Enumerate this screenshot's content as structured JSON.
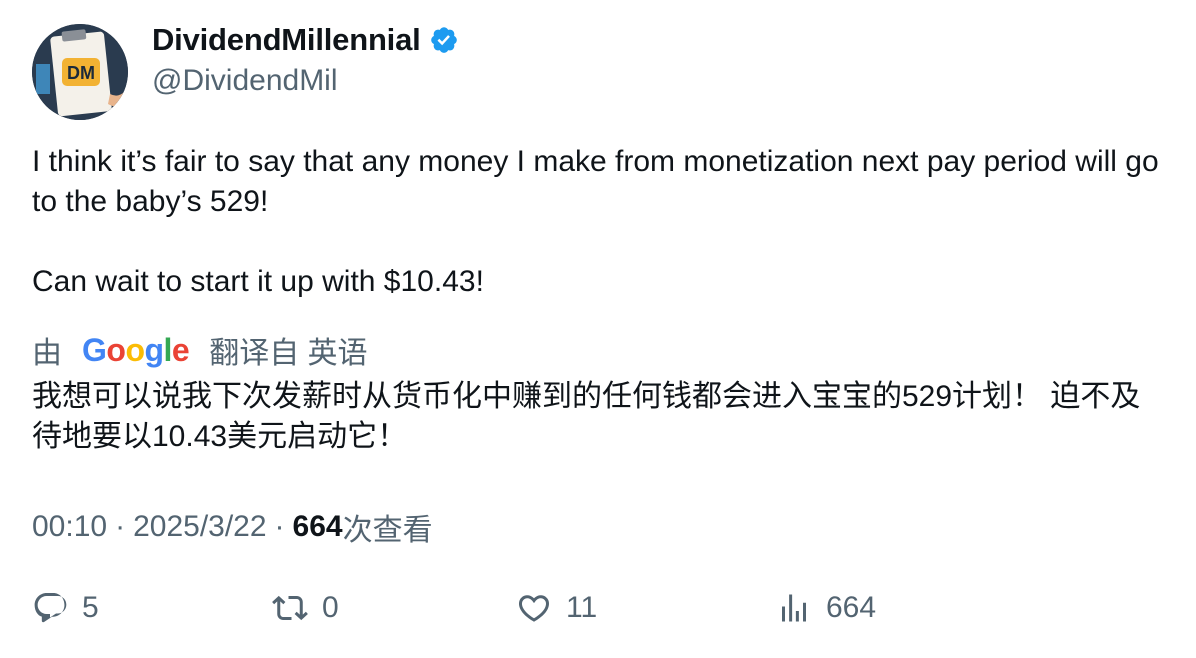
{
  "author": {
    "display_name": "DividendMillennial",
    "handle": "@DividendMil",
    "verified": true,
    "avatar_icon": "dm-logo-avatar",
    "avatar_text": "DM"
  },
  "tweet": {
    "text": "I think it’s fair to say that any money I make from monetization next pay period will go to the baby’s 529!\n\nCan wait to start it up with $10.43!"
  },
  "translation": {
    "prefix": "由",
    "provider": "Google",
    "suffix": "翻译自 英语",
    "text": "我想可以说我下次发薪时从货币化中赚到的任何钱都会进入宝宝的529计划！ 迫不及待地要以10.43美元启动它！"
  },
  "meta": {
    "time": "00:10",
    "date": "2025/3/22",
    "views": "664",
    "views_label": "次查看",
    "separator": "·"
  },
  "actions": {
    "replies": "5",
    "retweets": "0",
    "likes": "11",
    "views": "664"
  },
  "colors": {
    "text_primary": "#0f1419",
    "text_secondary": "#536471",
    "verified_blue": "#1d9bf0"
  }
}
